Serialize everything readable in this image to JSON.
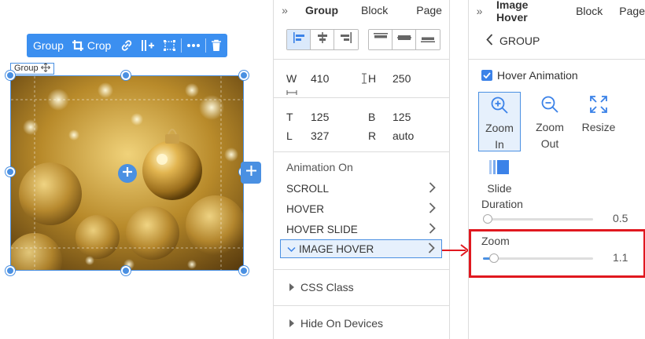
{
  "toolbar": {
    "group_label": "Group",
    "crop_label": "Crop",
    "icons": [
      "link-icon",
      "add-column-icon",
      "select-frame-icon",
      "more-icon",
      "trash-icon"
    ]
  },
  "canvas": {
    "group_tag": "Group",
    "image_description_colors": {
      "accent": "#4a90e2"
    }
  },
  "mid_panel": {
    "tabs": [
      {
        "label": "Group",
        "active": true
      },
      {
        "label": "Block",
        "active": false
      },
      {
        "label": "Page",
        "active": false
      }
    ],
    "dimensions": {
      "w_label": "W",
      "w_value": "410",
      "h_label": "H",
      "h_value": "250",
      "t_label": "T",
      "t_value": "125",
      "b_label": "B",
      "b_value": "125",
      "l_label": "L",
      "l_value": "327",
      "r_label": "R",
      "r_value": "auto"
    },
    "animation": {
      "title": "Animation On",
      "items": [
        {
          "label": "SCROLL",
          "selected": false
        },
        {
          "label": "HOVER",
          "selected": false
        },
        {
          "label": "HOVER SLIDE",
          "selected": false
        },
        {
          "label": "IMAGE HOVER",
          "selected": true
        }
      ]
    },
    "css_class": "CSS Class",
    "hide_on_devices": "Hide On Devices"
  },
  "right_panel": {
    "tabs": [
      {
        "label": "Image Hover",
        "active": true
      },
      {
        "label": "Block",
        "active": false
      },
      {
        "label": "Page",
        "active": false
      }
    ],
    "back_label": "GROUP",
    "hover_animation_label": "Hover Animation",
    "hover_animation_checked": true,
    "options": [
      {
        "label_line1": "Zoom",
        "label_line2": "In",
        "icon": "zoom-in-icon",
        "selected": true
      },
      {
        "label_line1": "Zoom",
        "label_line2": "Out",
        "icon": "zoom-out-icon",
        "selected": false
      },
      {
        "label_line1": "Resize",
        "label_line2": "",
        "icon": "resize-icon",
        "selected": false
      },
      {
        "label_line1": "Slide",
        "label_line2": "",
        "icon": "slide-icon",
        "selected": false
      }
    ],
    "duration": {
      "label": "Duration",
      "value": "0.5",
      "fraction": 0.0
    },
    "zoom": {
      "label": "Zoom",
      "value": "1.1",
      "fraction": 0.1
    }
  },
  "highlight_color": "#e0181f"
}
